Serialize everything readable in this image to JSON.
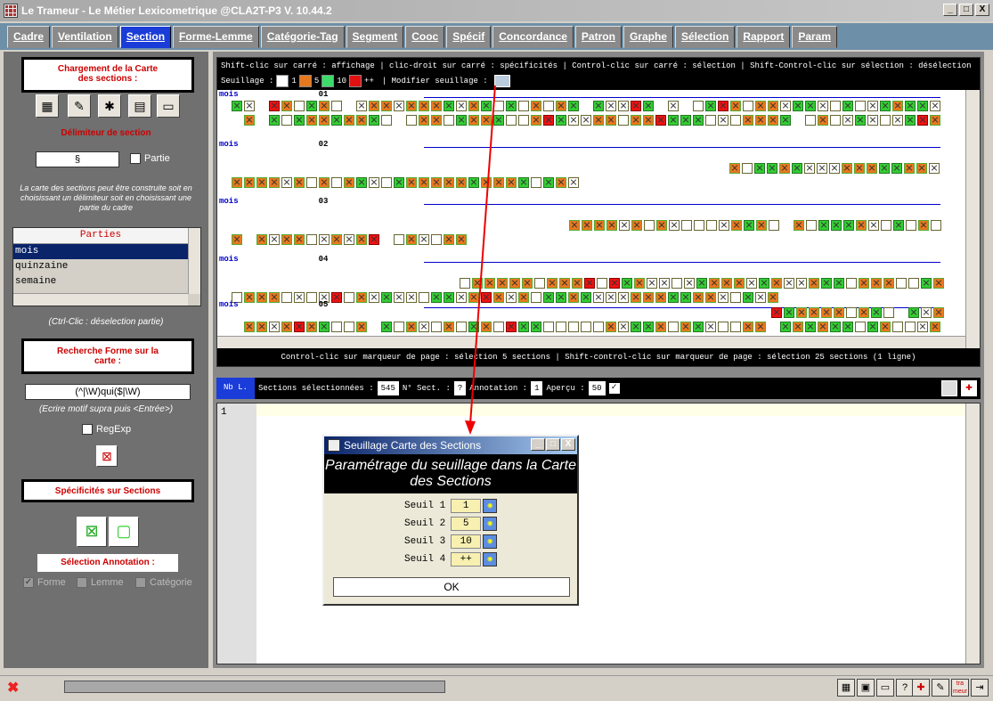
{
  "window": {
    "title": "Le Trameur - Le Métier Lexicometrique @CLA2T-P3 V. 10.44.2",
    "min": "_",
    "max": "□",
    "close": "X"
  },
  "tabs": [
    "Cadre",
    "Ventilation",
    "Section",
    "Forme-Lemme",
    "Catégorie-Tag",
    "Segment",
    "Cooc",
    "Spécif",
    "Concordance",
    "Patron",
    "Graphe",
    "Sélection",
    "Rapport",
    "Param"
  ],
  "left": {
    "load_title": "Chargement de la Carte des sections :",
    "delim_title": "Délimiteur de section",
    "delim_value": "§",
    "partie_label": "Partie",
    "info": "La carte des sections peut être construite soit en choisissant un délimiteur soit en choisissant une partie du cadre",
    "parts_header": "Parties",
    "parts": [
      "mois",
      "quinzaine",
      "semaine"
    ],
    "ctrl_note": "(Ctrl-Clic : déselection partie)",
    "search_title": "Recherche Forme sur la carte :",
    "search_value": "(^|\\W)qui($|\\W)",
    "search_note": "(Ecrire motif supra puis <Entrée>)",
    "regexp_label": "RegExp",
    "spec_title": "Spécificités sur Sections",
    "annot_title": "Sélection Annotation :",
    "annot_opts": [
      "Forme",
      "Lemme",
      "Catégorie"
    ]
  },
  "map": {
    "info_line1": "Shift-clic sur carré : affichage | clic-droit sur carré : spécificités | Control-clic sur carré : sélection | Shift-Control-clic sur sélection : désélection",
    "seuillage_label": "Seuillage :",
    "thresholds": [
      {
        "label": "1",
        "color": "#ffffff"
      },
      {
        "label": "5",
        "color": "#e8781e"
      },
      {
        "label": "10",
        "color": "#3ddc6a"
      },
      {
        "label": "++",
        "color": "#e11111"
      }
    ],
    "modify_label": "| Modifier seuillage :",
    "sections": [
      {
        "part": "mois",
        "num": "01"
      },
      {
        "part": "mois",
        "num": "02"
      },
      {
        "part": "mois",
        "num": "03"
      },
      {
        "part": "mois",
        "num": "04"
      },
      {
        "part": "mois",
        "num": "05"
      }
    ],
    "footer": "Control-clic sur marqueur de page : sélection 5 sections | Shift-control-clic sur marqueur de page : sélection 25 sections (1 ligne)"
  },
  "bar2": {
    "nbl": "Nb L.",
    "sel_label": "Sections sélectionnées :",
    "sel_val": "545",
    "nsect_label": "N° Sect. :",
    "nsect_val": "?",
    "annot_label": "Annotation :",
    "annot_val": "1",
    "apercu_label": "Aperçu :",
    "apercu_val": "50"
  },
  "text": {
    "line": "1"
  },
  "dialog": {
    "title": "Seuillage Carte des Sections",
    "header": "Paramétrage du seuillage dans la Carte des Sections",
    "rows": [
      {
        "label": "Seuil 1",
        "value": "1"
      },
      {
        "label": "Seuil 2",
        "value": "5"
      },
      {
        "label": "Seuil 3",
        "value": "10"
      },
      {
        "label": "Seuil 4",
        "value": "++"
      }
    ],
    "ok": "OK"
  }
}
